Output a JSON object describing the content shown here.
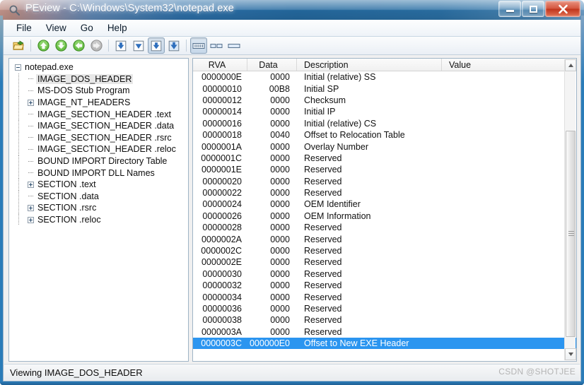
{
  "window": {
    "title": "PEview - C:\\Windows\\System32\\notepad.exe",
    "icon": "magnifier-icon",
    "minimize_label": "Minimize",
    "maximize_label": "Maximize",
    "close_label": "Close"
  },
  "menu": {
    "items": [
      {
        "label": "File",
        "name": "menu-file"
      },
      {
        "label": "View",
        "name": "menu-view"
      },
      {
        "label": "Go",
        "name": "menu-go"
      },
      {
        "label": "Help",
        "name": "menu-help"
      }
    ]
  },
  "toolbar": {
    "buttons": [
      {
        "name": "open-file-button",
        "icon": "open-folder-icon",
        "pressed": false
      },
      {
        "name": "go-up-button",
        "icon": "arrow-up-icon",
        "pressed": false
      },
      {
        "name": "go-down-button",
        "icon": "arrow-down-icon",
        "pressed": false
      },
      {
        "name": "go-back-button",
        "icon": "arrow-back-icon",
        "pressed": false
      },
      {
        "name": "go-forward-button",
        "icon": "arrow-forward-disabled-icon",
        "pressed": false
      },
      {
        "name": "view-hex-button",
        "icon": "blue-down-arrow-icon",
        "pressed": false
      },
      {
        "name": "view-text-button",
        "icon": "blue-chevron-down-icon",
        "pressed": false
      },
      {
        "name": "view-structure-button",
        "icon": "blue-boxed-arrow-icon",
        "pressed": true
      },
      {
        "name": "view-detail-button",
        "icon": "blue-filled-arrow-icon",
        "pressed": false
      },
      {
        "name": "layout-columns-button",
        "icon": "grid-columns-icon",
        "pressed": true
      },
      {
        "name": "layout-split-button",
        "icon": "split-panes-icon",
        "pressed": false
      },
      {
        "name": "layout-single-button",
        "icon": "single-pane-icon",
        "pressed": false
      }
    ]
  },
  "tree": {
    "root": {
      "label": "notepad.exe",
      "expanded": true
    },
    "items": [
      {
        "label": "IMAGE_DOS_HEADER",
        "marker": "leaf",
        "selected": true
      },
      {
        "label": "MS-DOS Stub Program",
        "marker": "leaf",
        "selected": false
      },
      {
        "label": "IMAGE_NT_HEADERS",
        "marker": "plus",
        "selected": false
      },
      {
        "label": "IMAGE_SECTION_HEADER .text",
        "marker": "leaf",
        "selected": false
      },
      {
        "label": "IMAGE_SECTION_HEADER .data",
        "marker": "leaf",
        "selected": false
      },
      {
        "label": "IMAGE_SECTION_HEADER .rsrc",
        "marker": "leaf",
        "selected": false
      },
      {
        "label": "IMAGE_SECTION_HEADER .reloc",
        "marker": "leaf",
        "selected": false
      },
      {
        "label": "BOUND IMPORT Directory Table",
        "marker": "leaf",
        "selected": false
      },
      {
        "label": "BOUND IMPORT DLL Names",
        "marker": "leaf",
        "selected": false
      },
      {
        "label": "SECTION .text",
        "marker": "plus",
        "selected": false
      },
      {
        "label": "SECTION .data",
        "marker": "leaf",
        "selected": false
      },
      {
        "label": "SECTION .rsrc",
        "marker": "plus",
        "selected": false
      },
      {
        "label": "SECTION .reloc",
        "marker": "plus",
        "selected": false
      }
    ]
  },
  "list": {
    "columns": [
      {
        "label": "RVA",
        "name": "column-rva"
      },
      {
        "label": "Data",
        "name": "column-data"
      },
      {
        "label": "Description",
        "name": "column-description"
      },
      {
        "label": "Value",
        "name": "column-value"
      }
    ],
    "rows": [
      {
        "rva": "0000000E",
        "data": "0000",
        "description": "Initial (relative) SS",
        "value": "",
        "selected": false
      },
      {
        "rva": "00000010",
        "data": "00B8",
        "description": "Initial SP",
        "value": "",
        "selected": false
      },
      {
        "rva": "00000012",
        "data": "0000",
        "description": "Checksum",
        "value": "",
        "selected": false
      },
      {
        "rva": "00000014",
        "data": "0000",
        "description": "Initial IP",
        "value": "",
        "selected": false
      },
      {
        "rva": "00000016",
        "data": "0000",
        "description": "Initial (relative) CS",
        "value": "",
        "selected": false
      },
      {
        "rva": "00000018",
        "data": "0040",
        "description": "Offset to Relocation Table",
        "value": "",
        "selected": false
      },
      {
        "rva": "0000001A",
        "data": "0000",
        "description": "Overlay Number",
        "value": "",
        "selected": false
      },
      {
        "rva": "0000001C",
        "data": "0000",
        "description": "Reserved",
        "value": "",
        "selected": false
      },
      {
        "rva": "0000001E",
        "data": "0000",
        "description": "Reserved",
        "value": "",
        "selected": false
      },
      {
        "rva": "00000020",
        "data": "0000",
        "description": "Reserved",
        "value": "",
        "selected": false
      },
      {
        "rva": "00000022",
        "data": "0000",
        "description": "Reserved",
        "value": "",
        "selected": false
      },
      {
        "rva": "00000024",
        "data": "0000",
        "description": "OEM Identifier",
        "value": "",
        "selected": false
      },
      {
        "rva": "00000026",
        "data": "0000",
        "description": "OEM Information",
        "value": "",
        "selected": false
      },
      {
        "rva": "00000028",
        "data": "0000",
        "description": "Reserved",
        "value": "",
        "selected": false
      },
      {
        "rva": "0000002A",
        "data": "0000",
        "description": "Reserved",
        "value": "",
        "selected": false
      },
      {
        "rva": "0000002C",
        "data": "0000",
        "description": "Reserved",
        "value": "",
        "selected": false
      },
      {
        "rva": "0000002E",
        "data": "0000",
        "description": "Reserved",
        "value": "",
        "selected": false
      },
      {
        "rva": "00000030",
        "data": "0000",
        "description": "Reserved",
        "value": "",
        "selected": false
      },
      {
        "rva": "00000032",
        "data": "0000",
        "description": "Reserved",
        "value": "",
        "selected": false
      },
      {
        "rva": "00000034",
        "data": "0000",
        "description": "Reserved",
        "value": "",
        "selected": false
      },
      {
        "rva": "00000036",
        "data": "0000",
        "description": "Reserved",
        "value": "",
        "selected": false
      },
      {
        "rva": "00000038",
        "data": "0000",
        "description": "Reserved",
        "value": "",
        "selected": false
      },
      {
        "rva": "0000003A",
        "data": "0000",
        "description": "Reserved",
        "value": "",
        "selected": false
      },
      {
        "rva": "0000003C",
        "data": "000000E0",
        "description": "Offset to New EXE Header",
        "value": "",
        "selected": true
      }
    ]
  },
  "statusbar": {
    "text": "Viewing IMAGE_DOS_HEADER",
    "watermark": "CSDN @SHOTJEE"
  },
  "colors": {
    "selection": "#2b95f0",
    "title_blue": "#24699f",
    "close_red": "#c0341c",
    "frame_blue": "#2b7cb8"
  }
}
